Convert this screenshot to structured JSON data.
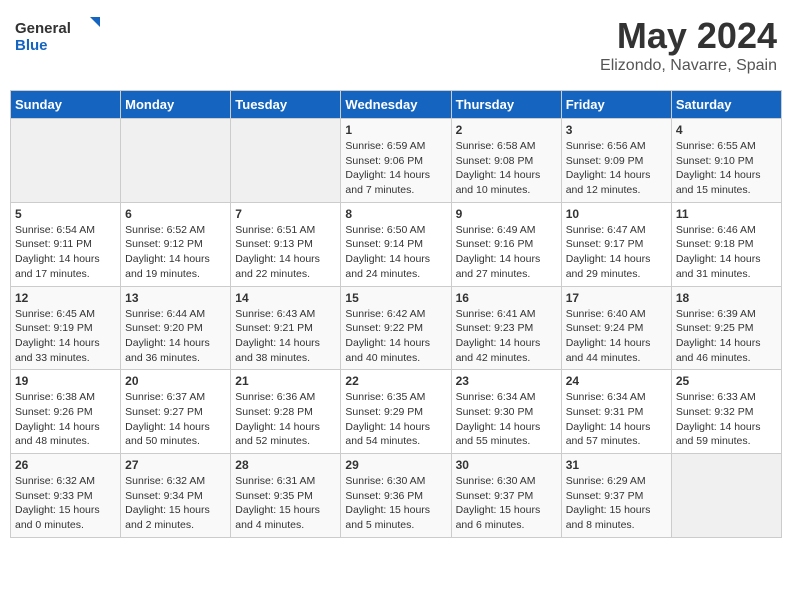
{
  "header": {
    "logo_general": "General",
    "logo_blue": "Blue",
    "month_title": "May 2024",
    "location": "Elizondo, Navarre, Spain"
  },
  "weekdays": [
    "Sunday",
    "Monday",
    "Tuesday",
    "Wednesday",
    "Thursday",
    "Friday",
    "Saturday"
  ],
  "weeks": [
    [
      {
        "day": "",
        "info": ""
      },
      {
        "day": "",
        "info": ""
      },
      {
        "day": "",
        "info": ""
      },
      {
        "day": "1",
        "info": "Sunrise: 6:59 AM\nSunset: 9:06 PM\nDaylight: 14 hours\nand 7 minutes."
      },
      {
        "day": "2",
        "info": "Sunrise: 6:58 AM\nSunset: 9:08 PM\nDaylight: 14 hours\nand 10 minutes."
      },
      {
        "day": "3",
        "info": "Sunrise: 6:56 AM\nSunset: 9:09 PM\nDaylight: 14 hours\nand 12 minutes."
      },
      {
        "day": "4",
        "info": "Sunrise: 6:55 AM\nSunset: 9:10 PM\nDaylight: 14 hours\nand 15 minutes."
      }
    ],
    [
      {
        "day": "5",
        "info": "Sunrise: 6:54 AM\nSunset: 9:11 PM\nDaylight: 14 hours\nand 17 minutes."
      },
      {
        "day": "6",
        "info": "Sunrise: 6:52 AM\nSunset: 9:12 PM\nDaylight: 14 hours\nand 19 minutes."
      },
      {
        "day": "7",
        "info": "Sunrise: 6:51 AM\nSunset: 9:13 PM\nDaylight: 14 hours\nand 22 minutes."
      },
      {
        "day": "8",
        "info": "Sunrise: 6:50 AM\nSunset: 9:14 PM\nDaylight: 14 hours\nand 24 minutes."
      },
      {
        "day": "9",
        "info": "Sunrise: 6:49 AM\nSunset: 9:16 PM\nDaylight: 14 hours\nand 27 minutes."
      },
      {
        "day": "10",
        "info": "Sunrise: 6:47 AM\nSunset: 9:17 PM\nDaylight: 14 hours\nand 29 minutes."
      },
      {
        "day": "11",
        "info": "Sunrise: 6:46 AM\nSunset: 9:18 PM\nDaylight: 14 hours\nand 31 minutes."
      }
    ],
    [
      {
        "day": "12",
        "info": "Sunrise: 6:45 AM\nSunset: 9:19 PM\nDaylight: 14 hours\nand 33 minutes."
      },
      {
        "day": "13",
        "info": "Sunrise: 6:44 AM\nSunset: 9:20 PM\nDaylight: 14 hours\nand 36 minutes."
      },
      {
        "day": "14",
        "info": "Sunrise: 6:43 AM\nSunset: 9:21 PM\nDaylight: 14 hours\nand 38 minutes."
      },
      {
        "day": "15",
        "info": "Sunrise: 6:42 AM\nSunset: 9:22 PM\nDaylight: 14 hours\nand 40 minutes."
      },
      {
        "day": "16",
        "info": "Sunrise: 6:41 AM\nSunset: 9:23 PM\nDaylight: 14 hours\nand 42 minutes."
      },
      {
        "day": "17",
        "info": "Sunrise: 6:40 AM\nSunset: 9:24 PM\nDaylight: 14 hours\nand 44 minutes."
      },
      {
        "day": "18",
        "info": "Sunrise: 6:39 AM\nSunset: 9:25 PM\nDaylight: 14 hours\nand 46 minutes."
      }
    ],
    [
      {
        "day": "19",
        "info": "Sunrise: 6:38 AM\nSunset: 9:26 PM\nDaylight: 14 hours\nand 48 minutes."
      },
      {
        "day": "20",
        "info": "Sunrise: 6:37 AM\nSunset: 9:27 PM\nDaylight: 14 hours\nand 50 minutes."
      },
      {
        "day": "21",
        "info": "Sunrise: 6:36 AM\nSunset: 9:28 PM\nDaylight: 14 hours\nand 52 minutes."
      },
      {
        "day": "22",
        "info": "Sunrise: 6:35 AM\nSunset: 9:29 PM\nDaylight: 14 hours\nand 54 minutes."
      },
      {
        "day": "23",
        "info": "Sunrise: 6:34 AM\nSunset: 9:30 PM\nDaylight: 14 hours\nand 55 minutes."
      },
      {
        "day": "24",
        "info": "Sunrise: 6:34 AM\nSunset: 9:31 PM\nDaylight: 14 hours\nand 57 minutes."
      },
      {
        "day": "25",
        "info": "Sunrise: 6:33 AM\nSunset: 9:32 PM\nDaylight: 14 hours\nand 59 minutes."
      }
    ],
    [
      {
        "day": "26",
        "info": "Sunrise: 6:32 AM\nSunset: 9:33 PM\nDaylight: 15 hours\nand 0 minutes."
      },
      {
        "day": "27",
        "info": "Sunrise: 6:32 AM\nSunset: 9:34 PM\nDaylight: 15 hours\nand 2 minutes."
      },
      {
        "day": "28",
        "info": "Sunrise: 6:31 AM\nSunset: 9:35 PM\nDaylight: 15 hours\nand 4 minutes."
      },
      {
        "day": "29",
        "info": "Sunrise: 6:30 AM\nSunset: 9:36 PM\nDaylight: 15 hours\nand 5 minutes."
      },
      {
        "day": "30",
        "info": "Sunrise: 6:30 AM\nSunset: 9:37 PM\nDaylight: 15 hours\nand 6 minutes."
      },
      {
        "day": "31",
        "info": "Sunrise: 6:29 AM\nSunset: 9:37 PM\nDaylight: 15 hours\nand 8 minutes."
      },
      {
        "day": "",
        "info": ""
      }
    ]
  ]
}
